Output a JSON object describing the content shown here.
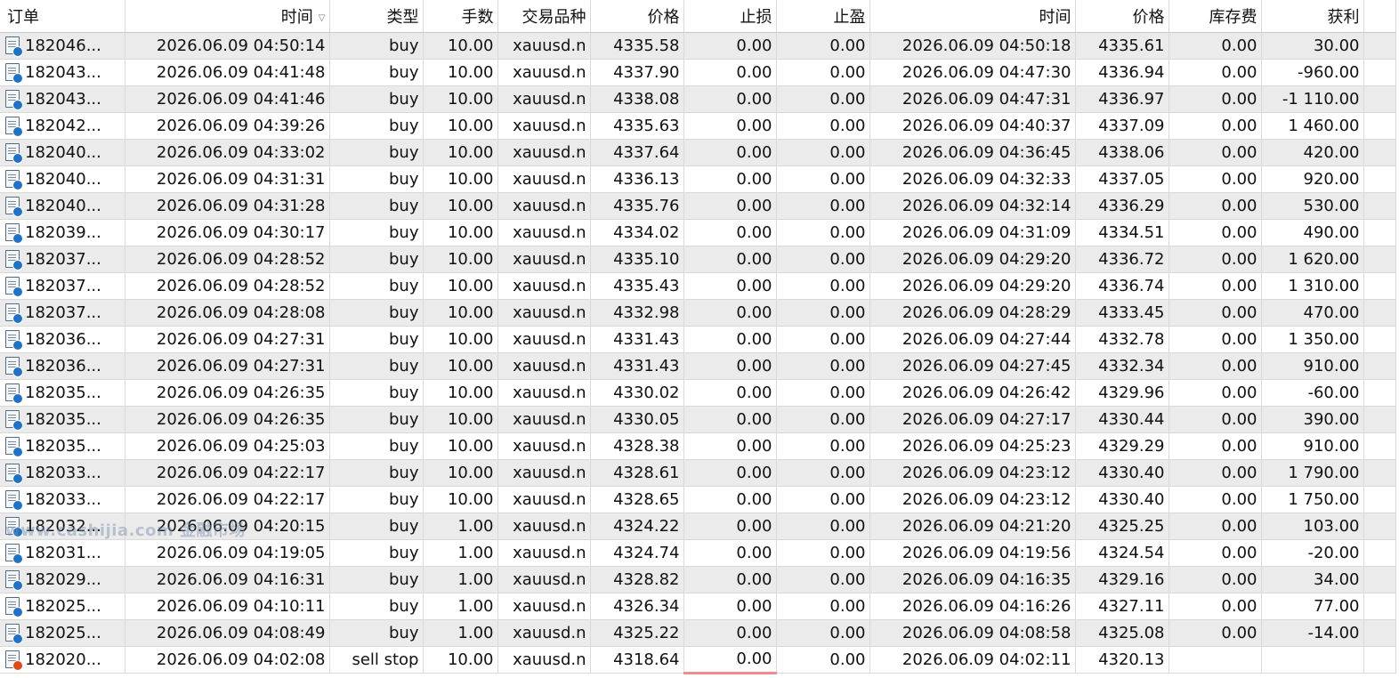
{
  "columns": [
    "订单",
    "时间",
    "类型",
    "手数",
    "交易品种",
    "价格",
    "止损",
    "止盈",
    "时间",
    "价格",
    "库存费",
    "获利"
  ],
  "watermark": "www.cashijia.com 金融市场",
  "rows": [
    {
      "order": "182046...",
      "open_time": "2026.06.09 04:50:14",
      "type": "buy",
      "lots": "10.00",
      "symbol": "xauusd.n",
      "price": "4335.58",
      "sl": "0.00",
      "tp": "0.00",
      "close_time": "2026.06.09 04:50:18",
      "close_price": "4335.61",
      "swap": "0.00",
      "profit": "30.00"
    },
    {
      "order": "182043...",
      "open_time": "2026.06.09 04:41:48",
      "type": "buy",
      "lots": "10.00",
      "symbol": "xauusd.n",
      "price": "4337.90",
      "sl": "0.00",
      "tp": "0.00",
      "close_time": "2026.06.09 04:47:30",
      "close_price": "4336.94",
      "swap": "0.00",
      "profit": "-960.00"
    },
    {
      "order": "182043...",
      "open_time": "2026.06.09 04:41:46",
      "type": "buy",
      "lots": "10.00",
      "symbol": "xauusd.n",
      "price": "4338.08",
      "sl": "0.00",
      "tp": "0.00",
      "close_time": "2026.06.09 04:47:31",
      "close_price": "4336.97",
      "swap": "0.00",
      "profit": "-1 110.00"
    },
    {
      "order": "182042...",
      "open_time": "2026.06.09 04:39:26",
      "type": "buy",
      "lots": "10.00",
      "symbol": "xauusd.n",
      "price": "4335.63",
      "sl": "0.00",
      "tp": "0.00",
      "close_time": "2026.06.09 04:40:37",
      "close_price": "4337.09",
      "swap": "0.00",
      "profit": "1 460.00"
    },
    {
      "order": "182040...",
      "open_time": "2026.06.09 04:33:02",
      "type": "buy",
      "lots": "10.00",
      "symbol": "xauusd.n",
      "price": "4337.64",
      "sl": "0.00",
      "tp": "0.00",
      "close_time": "2026.06.09 04:36:45",
      "close_price": "4338.06",
      "swap": "0.00",
      "profit": "420.00"
    },
    {
      "order": "182040...",
      "open_time": "2026.06.09 04:31:31",
      "type": "buy",
      "lots": "10.00",
      "symbol": "xauusd.n",
      "price": "4336.13",
      "sl": "0.00",
      "tp": "0.00",
      "close_time": "2026.06.09 04:32:33",
      "close_price": "4337.05",
      "swap": "0.00",
      "profit": "920.00"
    },
    {
      "order": "182040...",
      "open_time": "2026.06.09 04:31:28",
      "type": "buy",
      "lots": "10.00",
      "symbol": "xauusd.n",
      "price": "4335.76",
      "sl": "0.00",
      "tp": "0.00",
      "close_time": "2026.06.09 04:32:14",
      "close_price": "4336.29",
      "swap": "0.00",
      "profit": "530.00"
    },
    {
      "order": "182039...",
      "open_time": "2026.06.09 04:30:17",
      "type": "buy",
      "lots": "10.00",
      "symbol": "xauusd.n",
      "price": "4334.02",
      "sl": "0.00",
      "tp": "0.00",
      "close_time": "2026.06.09 04:31:09",
      "close_price": "4334.51",
      "swap": "0.00",
      "profit": "490.00"
    },
    {
      "order": "182037...",
      "open_time": "2026.06.09 04:28:52",
      "type": "buy",
      "lots": "10.00",
      "symbol": "xauusd.n",
      "price": "4335.10",
      "sl": "0.00",
      "tp": "0.00",
      "close_time": "2026.06.09 04:29:20",
      "close_price": "4336.72",
      "swap": "0.00",
      "profit": "1 620.00"
    },
    {
      "order": "182037...",
      "open_time": "2026.06.09 04:28:52",
      "type": "buy",
      "lots": "10.00",
      "symbol": "xauusd.n",
      "price": "4335.43",
      "sl": "0.00",
      "tp": "0.00",
      "close_time": "2026.06.09 04:29:20",
      "close_price": "4336.74",
      "swap": "0.00",
      "profit": "1 310.00"
    },
    {
      "order": "182037...",
      "open_time": "2026.06.09 04:28:08",
      "type": "buy",
      "lots": "10.00",
      "symbol": "xauusd.n",
      "price": "4332.98",
      "sl": "0.00",
      "tp": "0.00",
      "close_time": "2026.06.09 04:28:29",
      "close_price": "4333.45",
      "swap": "0.00",
      "profit": "470.00"
    },
    {
      "order": "182036...",
      "open_time": "2026.06.09 04:27:31",
      "type": "buy",
      "lots": "10.00",
      "symbol": "xauusd.n",
      "price": "4331.43",
      "sl": "0.00",
      "tp": "0.00",
      "close_time": "2026.06.09 04:27:44",
      "close_price": "4332.78",
      "swap": "0.00",
      "profit": "1 350.00"
    },
    {
      "order": "182036...",
      "open_time": "2026.06.09 04:27:31",
      "type": "buy",
      "lots": "10.00",
      "symbol": "xauusd.n",
      "price": "4331.43",
      "sl": "0.00",
      "tp": "0.00",
      "close_time": "2026.06.09 04:27:45",
      "close_price": "4332.34",
      "swap": "0.00",
      "profit": "910.00"
    },
    {
      "order": "182035...",
      "open_time": "2026.06.09 04:26:35",
      "type": "buy",
      "lots": "10.00",
      "symbol": "xauusd.n",
      "price": "4330.02",
      "sl": "0.00",
      "tp": "0.00",
      "close_time": "2026.06.09 04:26:42",
      "close_price": "4329.96",
      "swap": "0.00",
      "profit": "-60.00"
    },
    {
      "order": "182035...",
      "open_time": "2026.06.09 04:26:35",
      "type": "buy",
      "lots": "10.00",
      "symbol": "xauusd.n",
      "price": "4330.05",
      "sl": "0.00",
      "tp": "0.00",
      "close_time": "2026.06.09 04:27:17",
      "close_price": "4330.44",
      "swap": "0.00",
      "profit": "390.00"
    },
    {
      "order": "182035...",
      "open_time": "2026.06.09 04:25:03",
      "type": "buy",
      "lots": "10.00",
      "symbol": "xauusd.n",
      "price": "4328.38",
      "sl": "0.00",
      "tp": "0.00",
      "close_time": "2026.06.09 04:25:23",
      "close_price": "4329.29",
      "swap": "0.00",
      "profit": "910.00"
    },
    {
      "order": "182033...",
      "open_time": "2026.06.09 04:22:17",
      "type": "buy",
      "lots": "10.00",
      "symbol": "xauusd.n",
      "price": "4328.61",
      "sl": "0.00",
      "tp": "0.00",
      "close_time": "2026.06.09 04:23:12",
      "close_price": "4330.40",
      "swap": "0.00",
      "profit": "1 790.00"
    },
    {
      "order": "182033...",
      "open_time": "2026.06.09 04:22:17",
      "type": "buy",
      "lots": "10.00",
      "symbol": "xauusd.n",
      "price": "4328.65",
      "sl": "0.00",
      "tp": "0.00",
      "close_time": "2026.06.09 04:23:12",
      "close_price": "4330.40",
      "swap": "0.00",
      "profit": "1 750.00"
    },
    {
      "order": "182032...",
      "open_time": "2026.06.09 04:20:15",
      "type": "buy",
      "lots": "1.00",
      "symbol": "xauusd.n",
      "price": "4324.22",
      "sl": "0.00",
      "tp": "0.00",
      "close_time": "2026.06.09 04:21:20",
      "close_price": "4325.25",
      "swap": "0.00",
      "profit": "103.00"
    },
    {
      "order": "182031...",
      "open_time": "2026.06.09 04:19:05",
      "type": "buy",
      "lots": "1.00",
      "symbol": "xauusd.n",
      "price": "4324.74",
      "sl": "0.00",
      "tp": "0.00",
      "close_time": "2026.06.09 04:19:56",
      "close_price": "4324.54",
      "swap": "0.00",
      "profit": "-20.00"
    },
    {
      "order": "182029...",
      "open_time": "2026.06.09 04:16:31",
      "type": "buy",
      "lots": "1.00",
      "symbol": "xauusd.n",
      "price": "4328.82",
      "sl": "0.00",
      "tp": "0.00",
      "close_time": "2026.06.09 04:16:35",
      "close_price": "4329.16",
      "swap": "0.00",
      "profit": "34.00"
    },
    {
      "order": "182025...",
      "open_time": "2026.06.09 04:10:11",
      "type": "buy",
      "lots": "1.00",
      "symbol": "xauusd.n",
      "price": "4326.34",
      "sl": "0.00",
      "tp": "0.00",
      "close_time": "2026.06.09 04:16:26",
      "close_price": "4327.11",
      "swap": "0.00",
      "profit": "77.00"
    },
    {
      "order": "182025...",
      "open_time": "2026.06.09 04:08:49",
      "type": "buy",
      "lots": "1.00",
      "symbol": "xauusd.n",
      "price": "4325.22",
      "sl": "0.00",
      "tp": "0.00",
      "close_time": "2026.06.09 04:08:58",
      "close_price": "4325.08",
      "swap": "0.00",
      "profit": "-14.00"
    },
    {
      "order": "182020...",
      "open_time": "2026.06.09 04:02:08",
      "type": "sell stop",
      "lots": "10.00",
      "symbol": "xauusd.n",
      "price": "4318.64",
      "sl": "0.00",
      "tp": "0.00",
      "close_time": "2026.06.09 04:02:11",
      "close_price": "4320.13",
      "swap": "",
      "profit": ""
    }
  ]
}
